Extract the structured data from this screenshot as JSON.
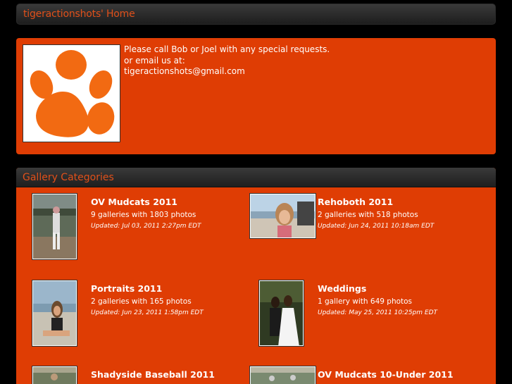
{
  "header": {
    "title": "tigeractionshots' Home"
  },
  "contact": {
    "line1": "Please call Bob or Joel with any special requests.",
    "line2": "or email us at:",
    "email": "tigeractionshots@gmail.com"
  },
  "gallery": {
    "title": "Gallery Categories",
    "categories": [
      {
        "title": "OV Mudcats 2011",
        "count": "9 galleries with 1803 photos",
        "updated": "Updated: Jul 03, 2011 2:27pm EDT"
      },
      {
        "title": "Rehoboth 2011",
        "count": "2 galleries with 518 photos",
        "updated": "Updated: Jun 24, 2011 10:18am EDT"
      },
      {
        "title": "Portraits 2011",
        "count": "2 galleries with 165 photos",
        "updated": "Updated: Jun 23, 2011 1:58pm EDT"
      },
      {
        "title": "Weddings",
        "count": "1 gallery with 649 photos",
        "updated": "Updated: May 25, 2011 10:25pm EDT"
      },
      {
        "title": "Shadyside Baseball 2011",
        "count": "",
        "updated": ""
      },
      {
        "title": "OV Mudcats 10-Under 2011",
        "count": "",
        "updated": ""
      }
    ]
  },
  "colors": {
    "accent": "#df3d04",
    "paw": "#f26a12",
    "header_text": "#e0501a"
  }
}
